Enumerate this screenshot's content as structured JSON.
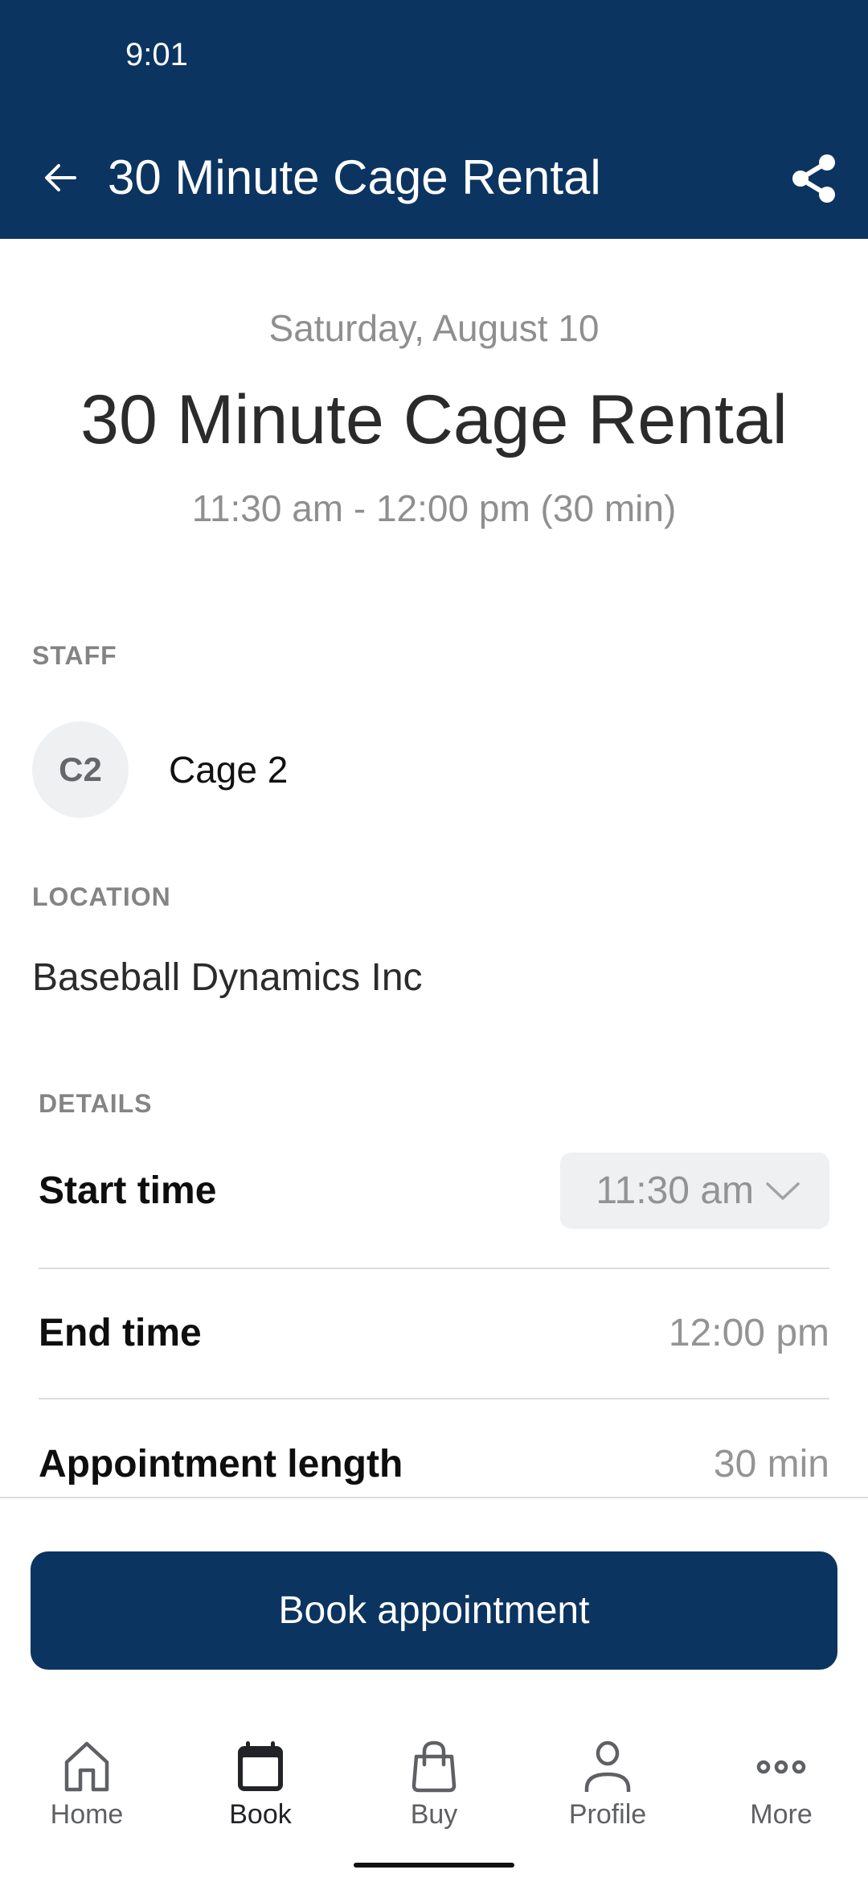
{
  "status_bar": {
    "time": "9:01"
  },
  "header": {
    "title": "30 Minute Cage Rental",
    "back_icon": "arrow-left-icon",
    "share_icon": "share-icon"
  },
  "appointment": {
    "date": "Saturday, August 10",
    "title": "30 Minute Cage Rental",
    "time_range": "11:30 am - 12:00 pm (30 min)"
  },
  "staff": {
    "label": "STAFF",
    "initials": "C2",
    "name": "Cage 2"
  },
  "location": {
    "label": "LOCATION",
    "name": "Baseball Dynamics Inc"
  },
  "details": {
    "label": "DETAILS",
    "rows": [
      {
        "label": "Start time",
        "value": "11:30 am"
      },
      {
        "label": "End time",
        "value": "12:00 pm"
      },
      {
        "label": "Appointment length",
        "value": "30 min"
      }
    ]
  },
  "book_button": {
    "label": "Book appointment"
  },
  "tabbar": {
    "active": "Book",
    "items": [
      {
        "label": "Home",
        "icon": "home-icon"
      },
      {
        "label": "Book",
        "icon": "calendar-icon"
      },
      {
        "label": "Buy",
        "icon": "shopping-bag-icon"
      },
      {
        "label": "Profile",
        "icon": "person-icon"
      },
      {
        "label": "More",
        "icon": "more-dots-icon"
      }
    ]
  },
  "colors": {
    "brand": "#0c3461",
    "secondary_text": "#8f8f8f",
    "avatar_bg": "#eef0f2"
  }
}
